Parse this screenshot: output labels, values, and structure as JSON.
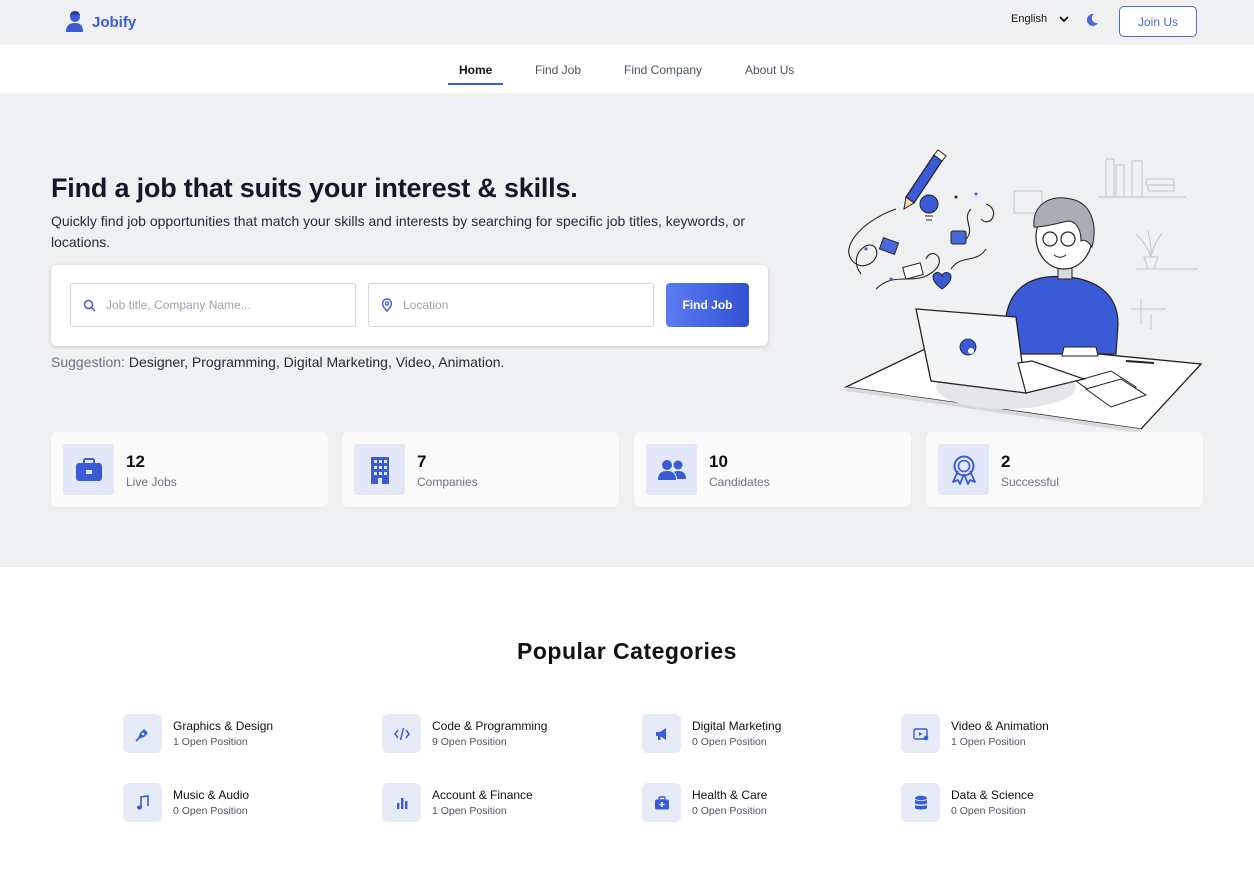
{
  "brand": {
    "name": "Jobify",
    "accent": "#3b5bd6"
  },
  "header": {
    "language": "English",
    "language_icon": "chevron-down-icon",
    "theme_icon": "moon-icon",
    "join_label": "Join Us"
  },
  "nav": {
    "items": [
      {
        "label": "Home",
        "active": true
      },
      {
        "label": "Find Job",
        "active": false
      },
      {
        "label": "Find Company",
        "active": false
      },
      {
        "label": "About Us",
        "active": false
      }
    ]
  },
  "hero": {
    "title": "Find a job that suits your interest & skills.",
    "subtitle": "Quickly find job opportunities that match your skills and interests by searching for specific job titles, keywords, or locations.",
    "search": {
      "keyword_placeholder": "Job title, Company Name...",
      "location_placeholder": "Location",
      "button_label": "Find Job"
    },
    "suggestion_label": "Suggestion:",
    "suggestions": "Designer, Programming, Digital Marketing, Video, Animation."
  },
  "stats": [
    {
      "value": "12",
      "label": "Live Jobs",
      "icon": "briefcase-icon"
    },
    {
      "value": "7",
      "label": "Companies",
      "icon": "building-icon"
    },
    {
      "value": "10",
      "label": "Candidates",
      "icon": "users-icon"
    },
    {
      "value": "2",
      "label": "Successful",
      "icon": "award-icon"
    }
  ],
  "categories": {
    "title": "Popular Categories",
    "items": [
      {
        "name": "Graphics & Design",
        "count": "1 Open Position",
        "icon": "pen-tool-icon"
      },
      {
        "name": "Code & Programming",
        "count": "9 Open Position",
        "icon": "code-icon"
      },
      {
        "name": "Digital Marketing",
        "count": "0 Open Position",
        "icon": "megaphone-icon"
      },
      {
        "name": "Video & Animation",
        "count": "1 Open Position",
        "icon": "video-icon"
      },
      {
        "name": "Music & Audio",
        "count": "0 Open Position",
        "icon": "music-icon"
      },
      {
        "name": "Account & Finance",
        "count": "1 Open Position",
        "icon": "bar-chart-icon"
      },
      {
        "name": "Health & Care",
        "count": "0 Open Position",
        "icon": "first-aid-icon"
      },
      {
        "name": "Data & Science",
        "count": "0 Open Position",
        "icon": "database-icon"
      }
    ]
  }
}
